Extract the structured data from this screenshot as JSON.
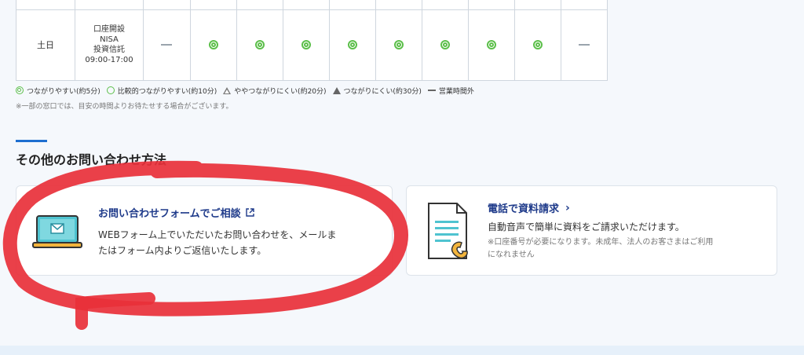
{
  "schedule": {
    "day_label": "土日",
    "service_lines": [
      "口座開設",
      "NISA",
      "投資信託",
      "09:00-17:00"
    ],
    "marks": [
      "dash",
      "double",
      "double",
      "double",
      "double",
      "double",
      "double",
      "double",
      "double",
      "dash"
    ]
  },
  "legend": {
    "items": [
      {
        "icon": "double-circle-icon",
        "label": "つながりやすい(約5分)"
      },
      {
        "icon": "circle-icon",
        "label": "比較的つながりやすい(約10分)"
      },
      {
        "icon": "open-triangle-icon",
        "label": "ややつながりにくい(約20分)"
      },
      {
        "icon": "triangle-icon",
        "label": "つながりにくい(約30分)"
      },
      {
        "icon": "dash-icon",
        "label": "営業時間外"
      }
    ],
    "note": "※一部の窓口では、目安の時間よりお待たせする場合がございます。"
  },
  "section": {
    "title": "その他のお問い合わせ方法"
  },
  "cards": {
    "form": {
      "title": "お問い合わせフォームでご相談",
      "desc_line1": "WEBフォーム上でいただいたお問い合わせを、メールま",
      "desc_line2": "たはフォーム内よりご返信いたします。"
    },
    "phone": {
      "title": "電話で資料請求",
      "desc": "自動音声で簡単に資料をご請求いただけます。",
      "sub_line1": "※口座番号が必要になります。未成年、法人のお客さまはご利用",
      "sub_line2": "になれません"
    }
  },
  "colors": {
    "accent": "#1e6fd0",
    "title_blue": "#1e3a8a",
    "green_mark": "#5cbf4a",
    "annotation_red": "#e8303a"
  }
}
